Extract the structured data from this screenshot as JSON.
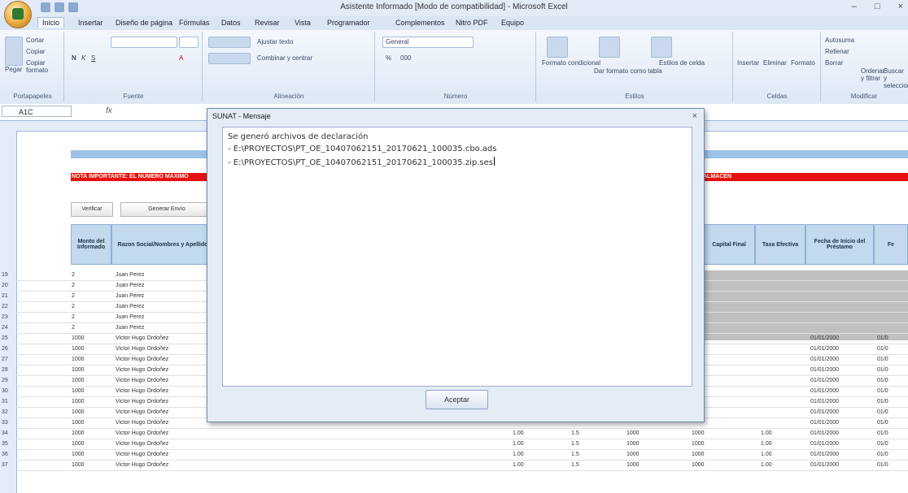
{
  "window": {
    "title": "Asistente Informado [Modo de compatibilidad] - Microsoft Excel",
    "controls": [
      "–",
      "□",
      "×"
    ]
  },
  "tabs": [
    "Inicio",
    "Insertar",
    "Diseño de página",
    "Fórmulas",
    "Datos",
    "Revisar",
    "Vista",
    "Programador",
    "Complementos",
    "Nitro PDF",
    "Equipo"
  ],
  "ribbon": {
    "groups": [
      {
        "label": "Portapapeles",
        "items": [
          "Pegar",
          "Cortar",
          "Copiar",
          "Copiar formato"
        ]
      },
      {
        "label": "Fuente",
        "items": [
          "N",
          "K",
          "S",
          "A"
        ]
      },
      {
        "label": "Alineación",
        "items": [
          "Ajustar texto",
          "Combinar y centrar"
        ]
      },
      {
        "label": "Número",
        "items": [
          "General",
          "%",
          "000"
        ]
      },
      {
        "label": "Estilos",
        "items": [
          "Formato condicional",
          "Dar formato como tabla",
          "Estilos de celda"
        ]
      },
      {
        "label": "Celdas",
        "items": [
          "Insertar",
          "Eliminar",
          "Formato"
        ]
      },
      {
        "label": "Modificar",
        "items": [
          "Autosuma",
          "Rellenar",
          "Borrar",
          "Ordenar y filtrar",
          "Buscar y seleccionar"
        ]
      }
    ]
  },
  "formula_bar": {
    "name_box": "A1C",
    "fx": "fx"
  },
  "sheet": {
    "banner_text": "NOTA IMPORTANTE: EL NUMERO MAXIMO",
    "banner_text_end": "ALMACEN",
    "buttons": [
      "Verificar",
      "Generar Envío"
    ],
    "headers": [
      "Monto del Informado",
      "Razon Social/Nombres y Apellidos",
      "Capital Final",
      "Tasa Efectiva",
      "Fecha de Inicio del Préstamo",
      "Fe"
    ],
    "row_numbers": [
      "9",
      "20",
      "21",
      "22",
      "23",
      "24",
      "25",
      "26",
      "27",
      "28",
      "29",
      "30",
      "31",
      "32",
      "33",
      "34",
      "35",
      "36",
      "37"
    ],
    "rows": [
      {
        "n": "19",
        "monto": "2",
        "nombre": "Juan Perez",
        "fecha": "",
        "tail": ""
      },
      {
        "n": "20",
        "monto": "2",
        "nombre": "Juan Perez",
        "fecha": "",
        "tail": ""
      },
      {
        "n": "21",
        "monto": "2",
        "nombre": "Juan Perez",
        "fecha": "",
        "tail": ""
      },
      {
        "n": "22",
        "monto": "2",
        "nombre": "Juan Perez",
        "fecha": "",
        "tail": ""
      },
      {
        "n": "23",
        "monto": "2",
        "nombre": "Juan Perez",
        "fecha": "",
        "tail": ""
      },
      {
        "n": "24",
        "monto": "2",
        "nombre": "Juan Perez",
        "fecha": "",
        "tail": ""
      },
      {
        "n": "25",
        "monto": "1000",
        "nombre": "Victor Hugo Ordoñez",
        "fecha": "01/01/2000",
        "tail": "01/0"
      },
      {
        "n": "26",
        "monto": "1000",
        "nombre": "Victor Hugo Ordoñez",
        "fecha": "01/01/2000",
        "tail": "01/0"
      },
      {
        "n": "27",
        "monto": "1000",
        "nombre": "Victor Hugo Ordoñez",
        "fecha": "01/01/2000",
        "tail": "01/0"
      },
      {
        "n": "28",
        "monto": "1000",
        "nombre": "Victor Hugo Ordoñez",
        "fecha": "01/01/2000",
        "tail": "01/0"
      },
      {
        "n": "29",
        "monto": "1000",
        "nombre": "Victor Hugo Ordoñez",
        "fecha": "01/01/2000",
        "tail": "01/0"
      },
      {
        "n": "30",
        "monto": "1000",
        "nombre": "Victor Hugo Ordoñez",
        "fecha": "01/01/2000",
        "tail": "01/0"
      },
      {
        "n": "31",
        "monto": "1000",
        "nombre": "Victor Hugo Ordoñez",
        "fecha": "01/01/2000",
        "tail": "01/0"
      },
      {
        "n": "32",
        "monto": "1000",
        "nombre": "Victor Hugo Ordoñez",
        "fecha": "01/01/2000",
        "tail": "01/0"
      },
      {
        "n": "33",
        "monto": "1000",
        "nombre": "Victor Hugo Ordoñez",
        "fecha": "01/01/2000",
        "tail": "01/0"
      },
      {
        "n": "34",
        "monto": "1000",
        "nombre": "Victor Hugo Ordoñez",
        "fecha": "01/01/2000",
        "tail": "01/0"
      },
      {
        "n": "35",
        "monto": "1000",
        "nombre": "Victor Hugo Ordoñez",
        "fecha": "01/01/2000",
        "tail": "01/0"
      },
      {
        "n": "36",
        "monto": "1000",
        "nombre": "Victor Hugo Ordoñez",
        "fecha": "01/01/2000",
        "tail": "01/0"
      },
      {
        "n": "37",
        "monto": "1000",
        "nombre": "Victor Hugo Ordoñez",
        "fecha": "01/01/2000",
        "tail": "01/0"
      }
    ],
    "extra_cols": [
      "1.00",
      "1.5",
      "1000",
      "1000",
      "1.00"
    ]
  },
  "dialog": {
    "title": "SUNAT - Mensaje",
    "close": "×",
    "lines": [
      "Se generó archivos de declaración",
      "- E:\\PROYECTOS\\PT_OE_10407062151_20170621_100035.cbo.ads",
      "- E:\\PROYECTOS\\PT_OE_10407062151_20170621_100035.zip.ses"
    ],
    "ok_label": "Aceptar"
  }
}
